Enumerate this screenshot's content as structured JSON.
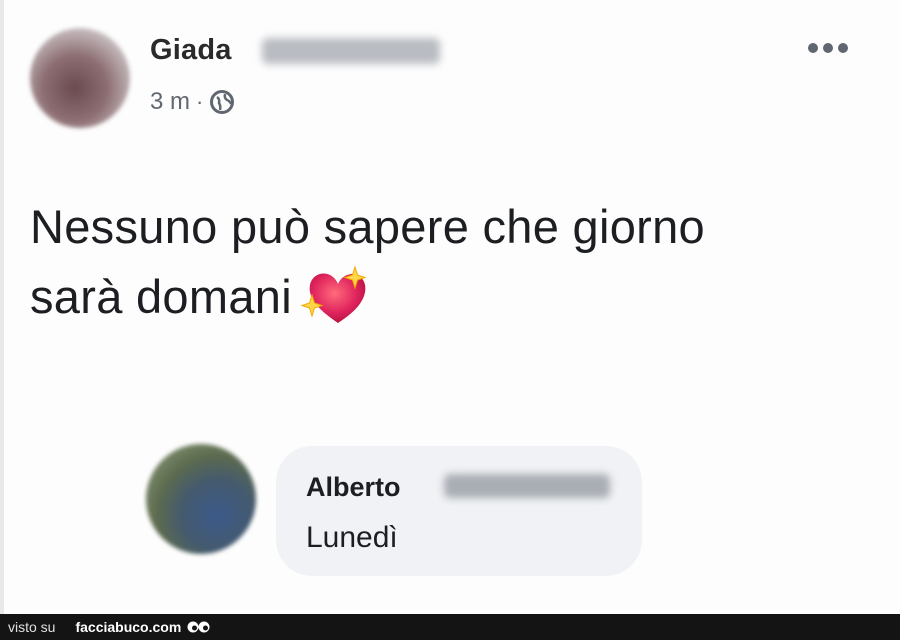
{
  "post": {
    "author_first_name": "Giada",
    "time": "3 m",
    "separator": "·",
    "privacy_icon": "globe-icon",
    "menu_icon": "more-options-icon",
    "text_line1": "Nessuno può sapere che giorno",
    "text_line2": "sarà domani",
    "emoji": "sparkling-heart-icon"
  },
  "comment": {
    "author_first_name": "Alberto",
    "text": "Lunedì"
  },
  "footer": {
    "seen_on": "visto su",
    "brand": "facciabuco.com"
  },
  "colors": {
    "bubble": "#f0f2f5",
    "meta_text": "#606770",
    "footer_bg": "#141414",
    "heart": "#e0245e"
  }
}
